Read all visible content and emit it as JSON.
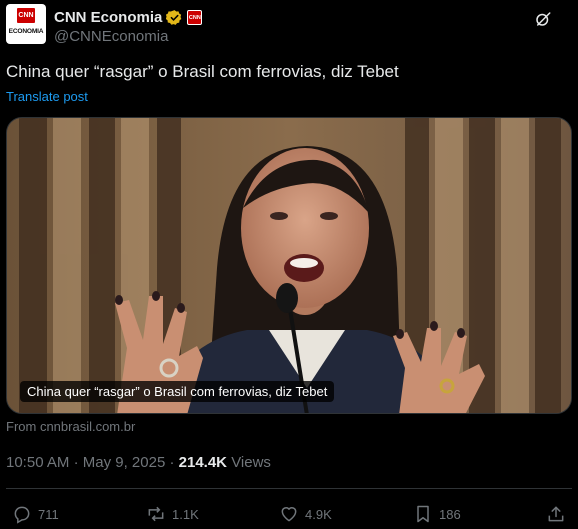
{
  "account": {
    "display_name": "CNN Economia",
    "handle": "@CNNEconomia",
    "avatar_logo": "CNN",
    "avatar_text": "ECONOMIA",
    "affiliate_badge": "CNN",
    "verified_color": "#e2b719"
  },
  "post": {
    "text": "China quer “rasgar” o Brasil com ferrovias, diz Tebet",
    "translate_label": "Translate post"
  },
  "media": {
    "caption": "China quer “rasgar” o Brasil com ferrovias, diz Tebet",
    "source": "From cnnbrasil.com.br"
  },
  "meta": {
    "time": "10:50 AM",
    "date": "May 9, 2025",
    "separator": "·",
    "views_count": "214.4K",
    "views_label": "Views"
  },
  "actions": {
    "replies": "711",
    "reposts": "1.1K",
    "likes": "4.9K",
    "bookmarks": "186"
  },
  "icons": {
    "grok": "grok-icon",
    "reply": "reply-icon",
    "repost": "repost-icon",
    "like": "heart-icon",
    "bookmark": "bookmark-icon",
    "share": "share-icon"
  },
  "colors": {
    "background": "#000000",
    "text_primary": "#e7e9ea",
    "text_secondary": "#71767b",
    "link": "#1d9bf0",
    "brand_red": "#cc0000"
  }
}
